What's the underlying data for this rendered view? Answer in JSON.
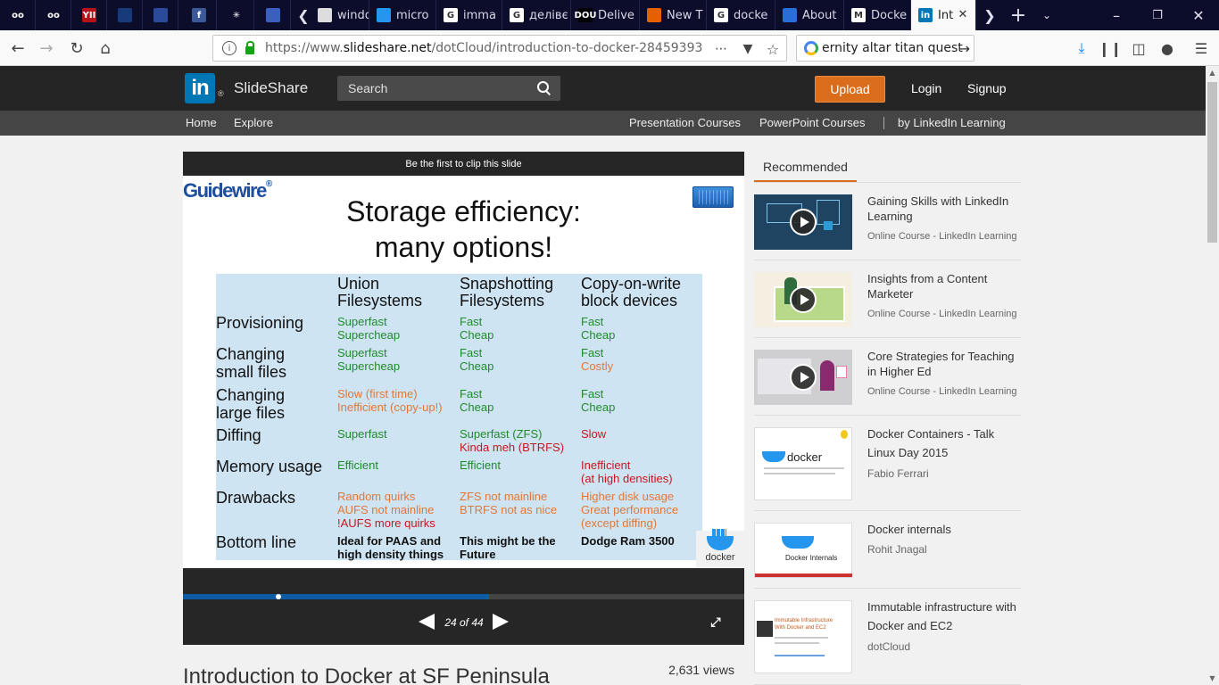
{
  "browser": {
    "tabs": [
      {
        "label": "",
        "fav": "owl-icon",
        "favtext": "oo",
        "favbg": "#0c0c2b",
        "pinned": true
      },
      {
        "label": "",
        "fav": "owl-icon",
        "favtext": "oo",
        "favbg": "#0c0c2b",
        "pinned": true
      },
      {
        "label": "",
        "fav": "yii-icon",
        "favtext": "YII",
        "favbg": "#b5121b",
        "pinned": true
      },
      {
        "label": "",
        "fav": "shield-icon",
        "favtext": "",
        "favbg": "#173a7a",
        "pinned": true
      },
      {
        "label": "",
        "fav": "globe-icon",
        "favtext": "",
        "favbg": "#2b4a9a",
        "pinned": true
      },
      {
        "label": "",
        "fav": "facebook-icon",
        "favtext": "f",
        "favbg": "#3b5998",
        "pinned": true
      },
      {
        "label": "",
        "fav": "asterisk-icon",
        "favtext": "✳",
        "favbg": "#0c0c2b",
        "pinned": true
      },
      {
        "label": "",
        "fav": "bootstrap-icon",
        "favtext": "",
        "favbg": "#3a5fbf",
        "pinned": true
      },
      {
        "label": "windo",
        "fav": "github-icon",
        "favtext": "",
        "favbg": "#dddddd",
        "pinned": false
      },
      {
        "label": "micro",
        "fav": "docker-icon",
        "favtext": "",
        "favbg": "#2496ed",
        "pinned": false
      },
      {
        "label": "imma",
        "fav": "google-icon",
        "favtext": "G",
        "favbg": "#ffffff",
        "pinned": false
      },
      {
        "label": "делівє",
        "fav": "google-icon",
        "favtext": "G",
        "favbg": "#ffffff",
        "pinned": false
      },
      {
        "label": "Delive",
        "fav": "dou-icon",
        "favtext": "DOU",
        "favbg": "#000000",
        "pinned": false
      },
      {
        "label": "New T",
        "fav": "firefox-icon",
        "favtext": "",
        "favbg": "#e66000",
        "pinned": false
      },
      {
        "label": "docke",
        "fav": "google-icon",
        "favtext": "G",
        "favbg": "#ffffff",
        "pinned": false
      },
      {
        "label": "About",
        "fav": "edge-icon",
        "favtext": "",
        "favbg": "#2a6dd6",
        "pinned": false
      },
      {
        "label": "Docke",
        "fav": "medium-icon",
        "favtext": "M",
        "favbg": "#ffffff",
        "pinned": false
      },
      {
        "label": "Int",
        "fav": "linkedin-icon",
        "favtext": "in",
        "favbg": "#0077b5",
        "pinned": false,
        "active": true
      }
    ],
    "url_prefix": "https://www.",
    "url_domain": "slideshare.net",
    "url_path": "/dotCloud/introduction-to-docker-28459393",
    "search_value": "ernity altar titan quest"
  },
  "site": {
    "logo_text": "SlideShare",
    "logo_mark": "in",
    "logo_reg": "®",
    "search_placeholder": "Search",
    "upload": "Upload",
    "login": "Login",
    "signup": "Signup",
    "nav": {
      "home": "Home",
      "explore": "Explore",
      "presentation_courses": "Presentation Courses",
      "powerpoint_courses": "PowerPoint Courses",
      "linkedin_learning": "by LinkedIn Learning"
    }
  },
  "player": {
    "clip_text": "Be the first to clip this slide",
    "counter": "24 of 44",
    "current_slide": 24,
    "total_slides": 44,
    "progress_fraction": 0.545
  },
  "slide": {
    "brand": "Guidewire",
    "title_line1": "Storage efficiency:",
    "title_line2": "many options!",
    "docker_text": "docker",
    "columns": [
      {
        "line1": "Union",
        "line2": "Filesystems"
      },
      {
        "line1": "Snapshotting",
        "line2": "Filesystems"
      },
      {
        "line1": "Copy-on-write",
        "line2": "block devices"
      }
    ],
    "rows": [
      {
        "label": [
          "Provisioning"
        ],
        "cells": [
          [
            [
              "Superfast",
              "green"
            ],
            [
              "Supercheap",
              "green"
            ]
          ],
          [
            [
              "Fast",
              "green"
            ],
            [
              "Cheap",
              "green"
            ]
          ],
          [
            [
              "Fast",
              "green"
            ],
            [
              "Cheap",
              "green"
            ]
          ]
        ]
      },
      {
        "label": [
          "Changing",
          "small files"
        ],
        "cells": [
          [
            [
              "Superfast",
              "green"
            ],
            [
              "Supercheap",
              "green"
            ]
          ],
          [
            [
              "Fast",
              "green"
            ],
            [
              "Cheap",
              "green"
            ]
          ],
          [
            [
              "Fast",
              "green"
            ],
            [
              "Costly",
              "orange"
            ]
          ]
        ]
      },
      {
        "label": [
          "Changing",
          "large files"
        ],
        "cells": [
          [
            [
              "Slow (first time)",
              "orange"
            ],
            [
              "Inefficient (copy-up!)",
              "orange"
            ]
          ],
          [
            [
              "Fast",
              "green"
            ],
            [
              "Cheap",
              "green"
            ]
          ],
          [
            [
              "Fast",
              "green"
            ],
            [
              "Cheap",
              "green"
            ]
          ]
        ]
      },
      {
        "label": [
          "Diffing"
        ],
        "cells": [
          [
            [
              "Superfast",
              "green"
            ]
          ],
          [
            [
              "Superfast (ZFS)",
              "green"
            ],
            [
              "Kinda meh (BTRFS)",
              "red"
            ]
          ],
          [
            [
              "Slow",
              "red"
            ]
          ]
        ]
      },
      {
        "label": [
          "Memory usage"
        ],
        "cells": [
          [
            [
              "Efficient",
              "green"
            ]
          ],
          [
            [
              "Efficient",
              "green"
            ]
          ],
          [
            [
              "Inefficient",
              "red"
            ],
            [
              "(at high densities)",
              "red"
            ]
          ]
        ]
      },
      {
        "label": [
          "Drawbacks"
        ],
        "cells": [
          [
            [
              "Random quirks",
              "orange"
            ],
            [
              "AUFS not mainline",
              "orange"
            ],
            [
              "!AUFS more quirks",
              "red"
            ]
          ],
          [
            [
              "ZFS not mainline",
              "orange"
            ],
            [
              "BTRFS not as nice",
              "orange"
            ]
          ],
          [
            [
              "Higher disk usage",
              "orange"
            ],
            [
              "Great performance",
              "orange"
            ],
            [
              "(except diffing)",
              "orange"
            ]
          ]
        ]
      },
      {
        "label": [
          "Bottom line"
        ],
        "cells": [
          [
            [
              "Ideal for PAAS and",
              "bold"
            ],
            [
              "high density things",
              "bold"
            ]
          ],
          [
            [
              "This might be the",
              "bold"
            ],
            [
              "Future",
              "bold"
            ]
          ],
          [
            [
              "Dodge Ram 3500",
              "bold"
            ]
          ]
        ]
      }
    ]
  },
  "page": {
    "title": "Introduction to Docker at SF Peninsula",
    "views": "2,631 views"
  },
  "recommended": {
    "tab_label": "Recommended",
    "items": [
      {
        "title": "Gaining Skills with LinkedIn Learning",
        "subtitle": "Online Course - LinkedIn Learning",
        "author": "",
        "thumb": "course-blue",
        "video": true
      },
      {
        "title": "Insights from a Content Marketer",
        "subtitle": "Online Course - LinkedIn Learning",
        "author": "",
        "thumb": "course-green",
        "video": true
      },
      {
        "title": "Core Strategies for Teaching in Higher Ed",
        "subtitle": "Online Course - LinkedIn Learning",
        "author": "",
        "thumb": "course-gray",
        "video": true
      },
      {
        "title": "Docker Containers - Talk Linux Day 2015",
        "subtitle": "",
        "author": "Fabio Ferrari",
        "thumb": "docker-white",
        "video": false
      },
      {
        "title": "Docker internals",
        "subtitle": "",
        "author": "Rohit Jnagal",
        "thumb": "docker-internals",
        "video": false
      },
      {
        "title": "Immutable infrastructure with Docker and EC2",
        "subtitle": "",
        "author": "dotCloud",
        "thumb": "immutable",
        "video": false
      }
    ]
  },
  "thumb_texts": {
    "docker_word": "docker",
    "internals": "Docker Internals",
    "immutable1": "Immutable Infrastructure",
    "immutable2": "With Docker and EC2"
  }
}
